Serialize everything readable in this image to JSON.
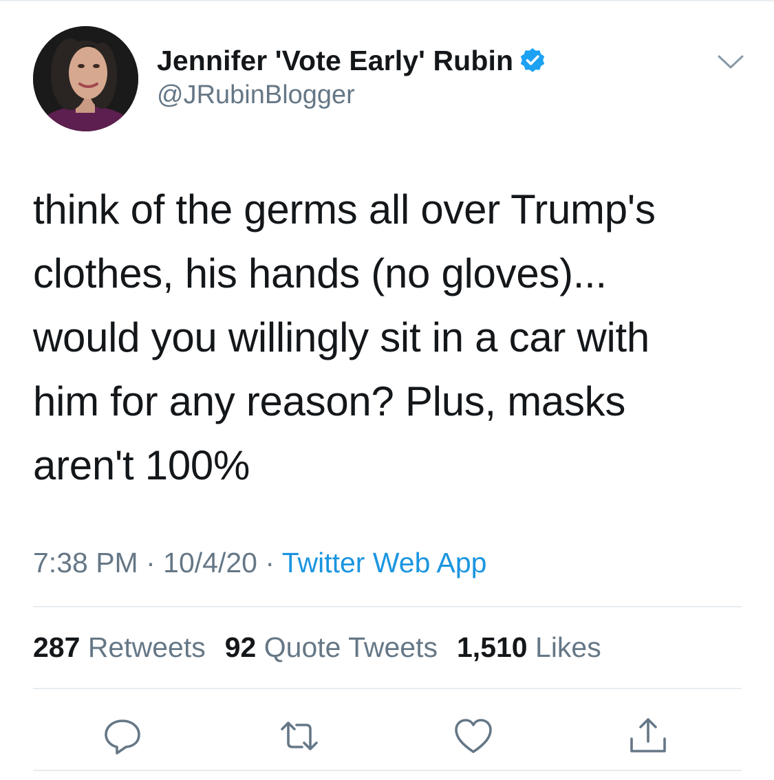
{
  "author": {
    "display_name": "Jennifer 'Vote Early' Rubin",
    "handle": "@JRubinBlogger",
    "verified_icon": "verified-badge-icon",
    "avatar": "profile-photo"
  },
  "tweet": {
    "lines": [
      "think of the germs all over Trump's",
      "clothes, his hands (no gloves)...",
      "would you willingly sit in a car with",
      "him for any reason? Plus, masks",
      "aren't 100%"
    ]
  },
  "meta": {
    "time": "7:38 PM",
    "separator": "·",
    "date": "10/4/20",
    "source": "Twitter Web App"
  },
  "stats": {
    "retweets_count": "287",
    "retweets_label": "Retweets",
    "quotes_count": "92",
    "quotes_label": "Quote Tweets",
    "likes_count": "1,510",
    "likes_label": "Likes"
  },
  "actions": [
    "reply-icon",
    "retweet-icon",
    "like-icon",
    "share-icon"
  ],
  "colors": {
    "text": "#14171a",
    "secondary": "#657786",
    "link": "#1b95e0",
    "verified": "#1da1f2",
    "divider": "#e6ecf0"
  }
}
